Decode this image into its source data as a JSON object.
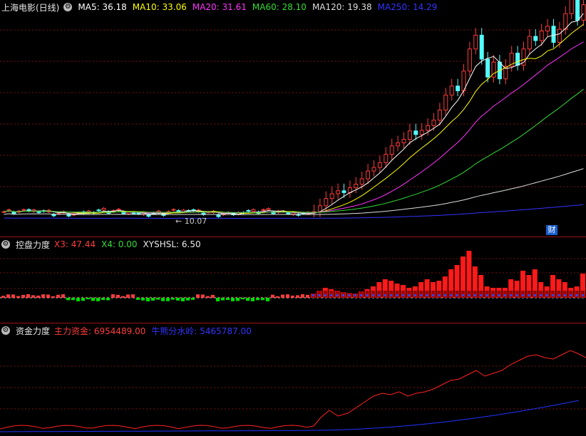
{
  "main": {
    "title": "上海电影(日线)",
    "ma": [
      {
        "label": "MA5: 36.18",
        "color": "#ffffff"
      },
      {
        "label": "MA10: 33.06",
        "color": "#ffff00"
      },
      {
        "label": "MA20: 31.61",
        "color": "#ff33ff"
      },
      {
        "label": "MA60: 28.10",
        "color": "#33dd33"
      },
      {
        "label": "MA120: 19.38",
        "color": "#dddddd"
      },
      {
        "label": "MA250: 14.29",
        "color": "#3333ff"
      }
    ],
    "low_label": "← 10.07",
    "badge": "财"
  },
  "control": {
    "title": "控盘力度",
    "x3": "X3: 47.44",
    "x4": "X4: 0.00",
    "xyshsl": "XYSHSL: 6.50"
  },
  "fund": {
    "title": "资金力度",
    "main_force": "主力资金: 6954489.00",
    "retail_line": "牛熊分水岭: 5465787.00"
  },
  "colors": {
    "up": "#ff3c3c",
    "down": "#54ffff",
    "neg": "#00dd00",
    "grid": "#7a1010"
  }
}
